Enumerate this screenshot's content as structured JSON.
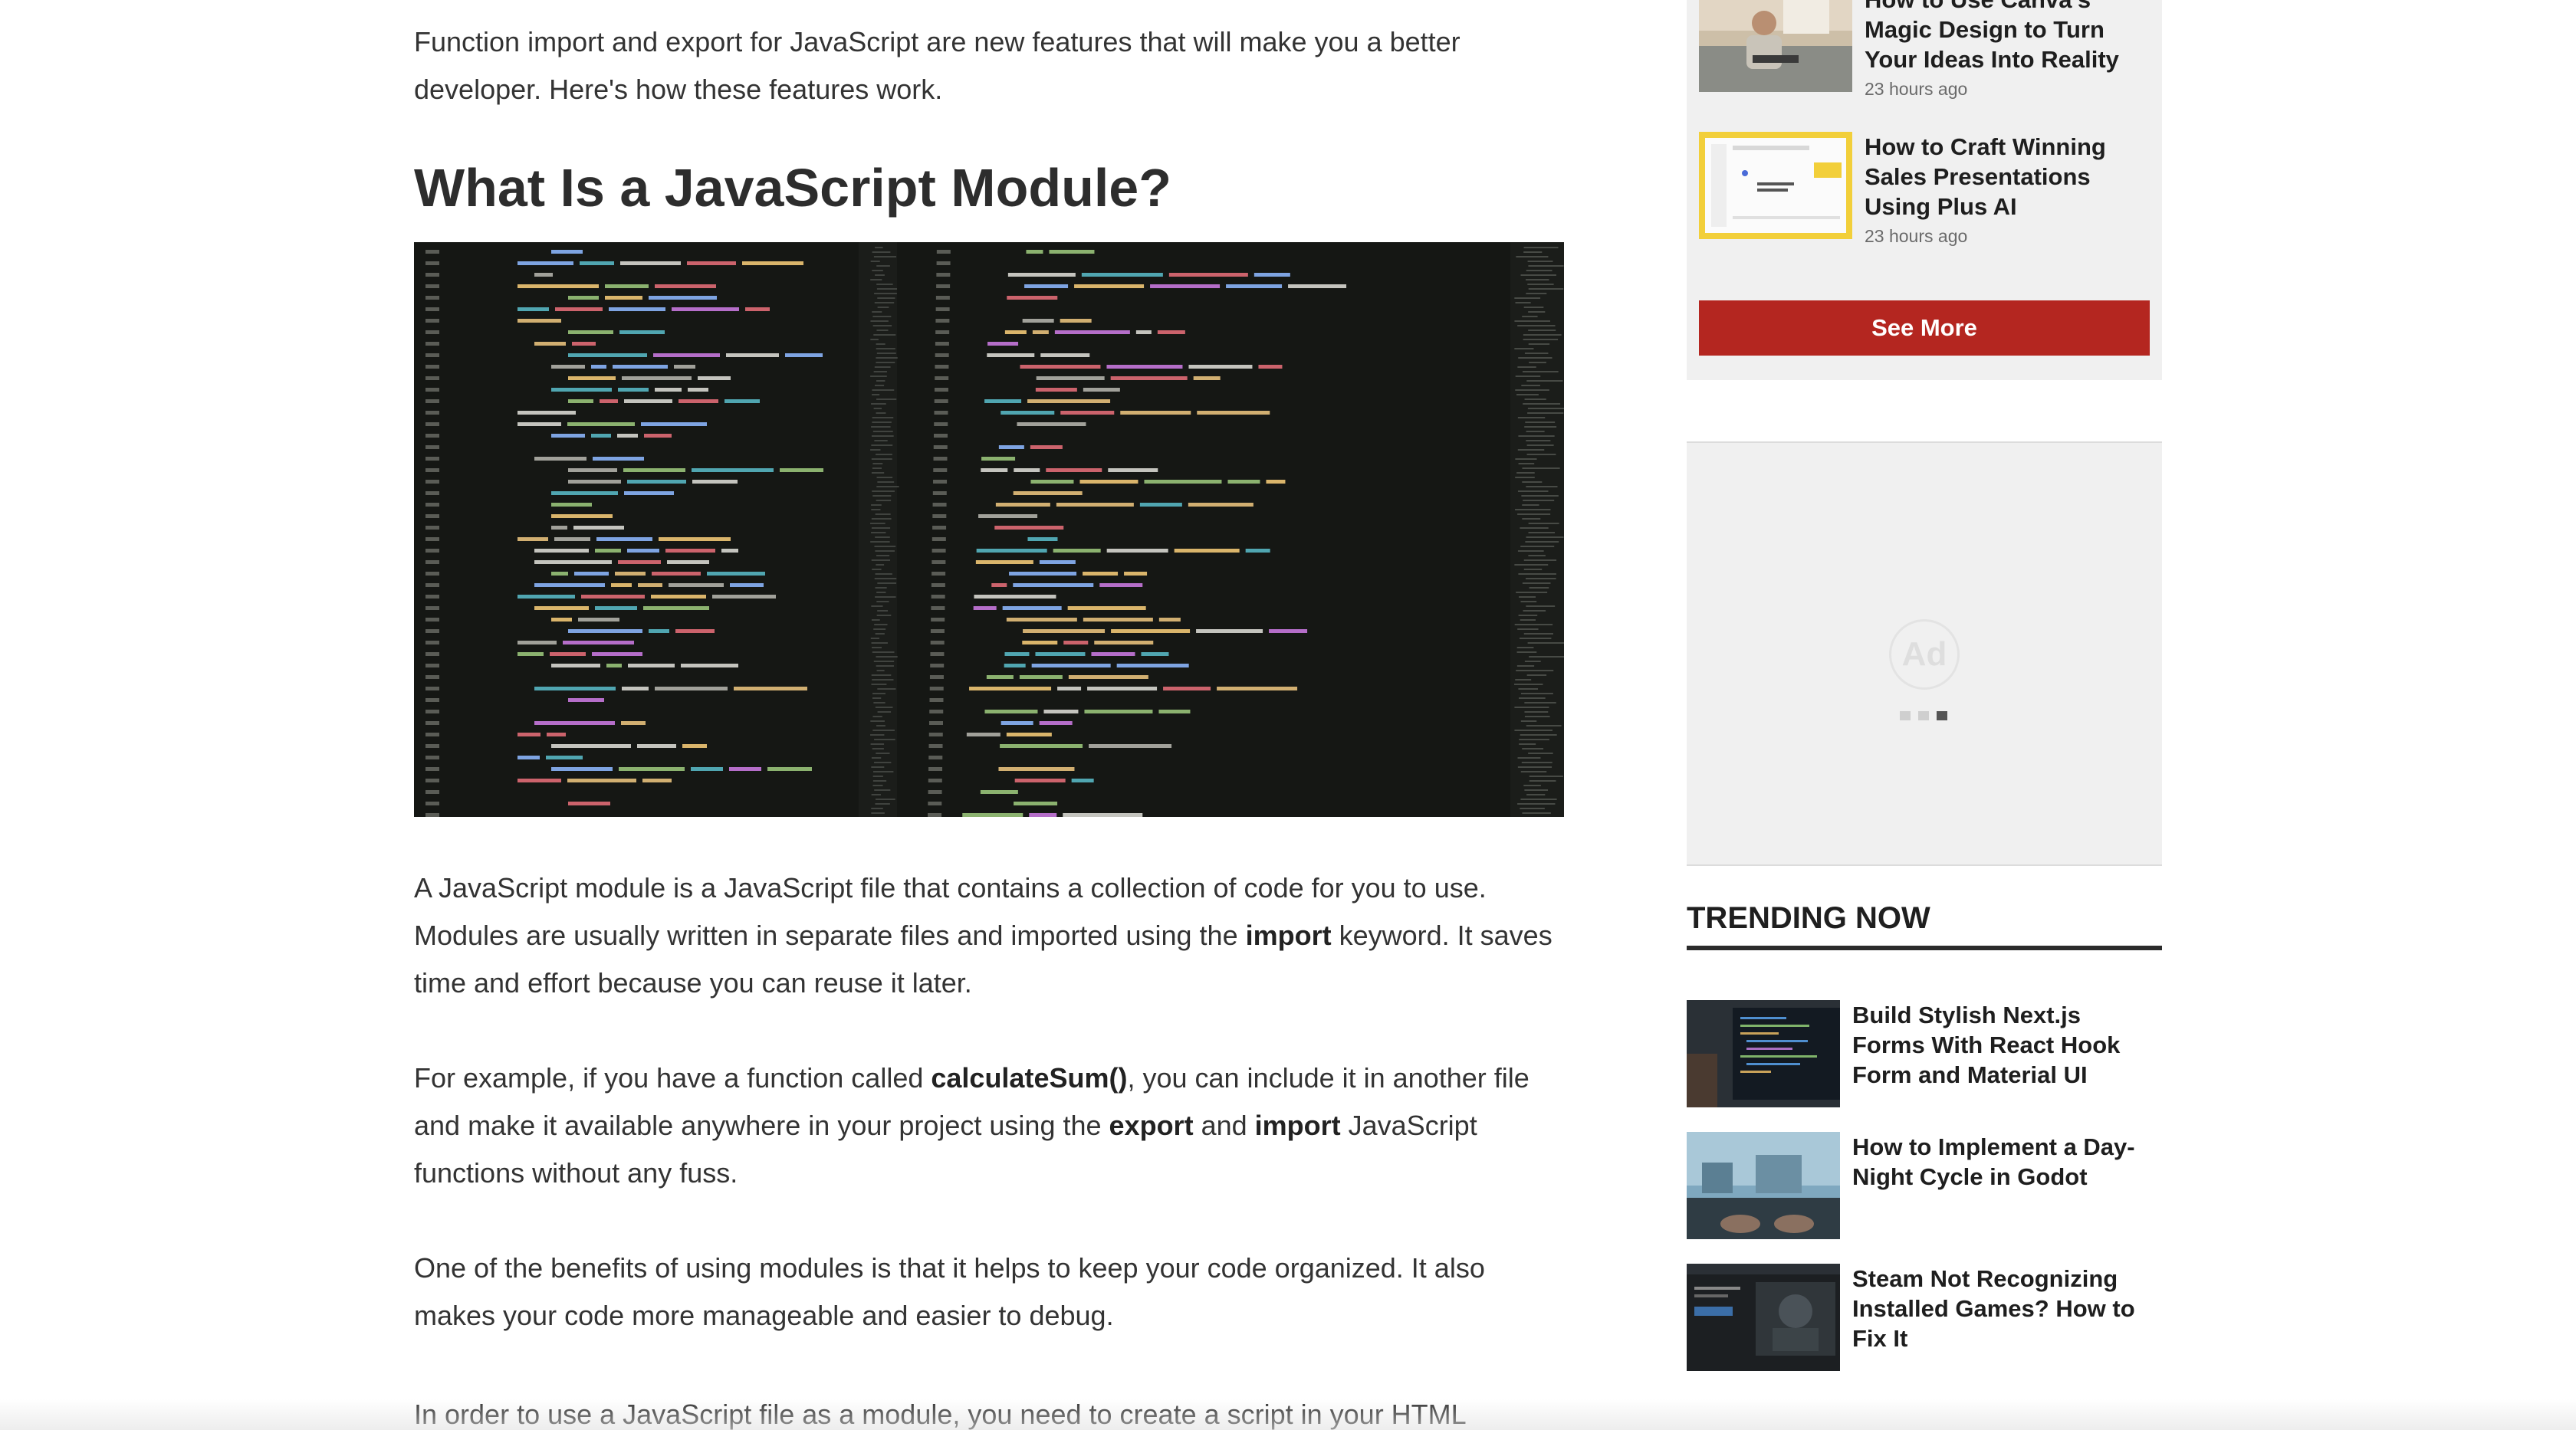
{
  "article": {
    "intro": "Function import and export for JavaScript are new features that will make you a better developer. Here's how these features work.",
    "heading": "What Is a JavaScript Module?",
    "hero_image": "code-editor-screenshot",
    "p1": {
      "t1": "A JavaScript module is a JavaScript file that contains a collection of code for you to use. Modules are usually written in separate files and imported using the ",
      "b1": "import",
      "t2": " keyword. It saves time and effort because you can reuse it later."
    },
    "p2": {
      "t1": "For example, if you have a function called ",
      "b1": "calculateSum()",
      "t2": ", you can include it in another file and make it available anywhere in your project using the ",
      "b2": "export",
      "t3": " and ",
      "b3": "import",
      "t4": " JavaScript functions without any fuss."
    },
    "p3": "One of the benefits of using modules is that it helps to keep your code organized. It also makes your code more manageable and easier to debug.",
    "p4": "In order to use a JavaScript file as a module, you need to create a script in your HTML"
  },
  "sidebar": {
    "latest": [
      {
        "title": "How to Use Canva's Magic Design to Turn Your Ideas Into Reality",
        "time": "23 hours ago"
      },
      {
        "title": "How to Craft Winning Sales Presentations Using Plus AI",
        "time": "23 hours ago"
      }
    ],
    "see_more": "See More",
    "ad_label": "Ad",
    "trending_heading": "TRENDING NOW",
    "trending": [
      {
        "title": "Build Stylish Next.js Forms With React Hook Form and Material UI"
      },
      {
        "title": "How to Implement a Day-Night Cycle in Godot"
      },
      {
        "title": "Steam Not Recognizing Installed Games? How to Fix It"
      }
    ]
  },
  "colors": {
    "accent_red": "#b42620",
    "sidebar_bg": "#f0f0f0",
    "text": "#333333"
  }
}
